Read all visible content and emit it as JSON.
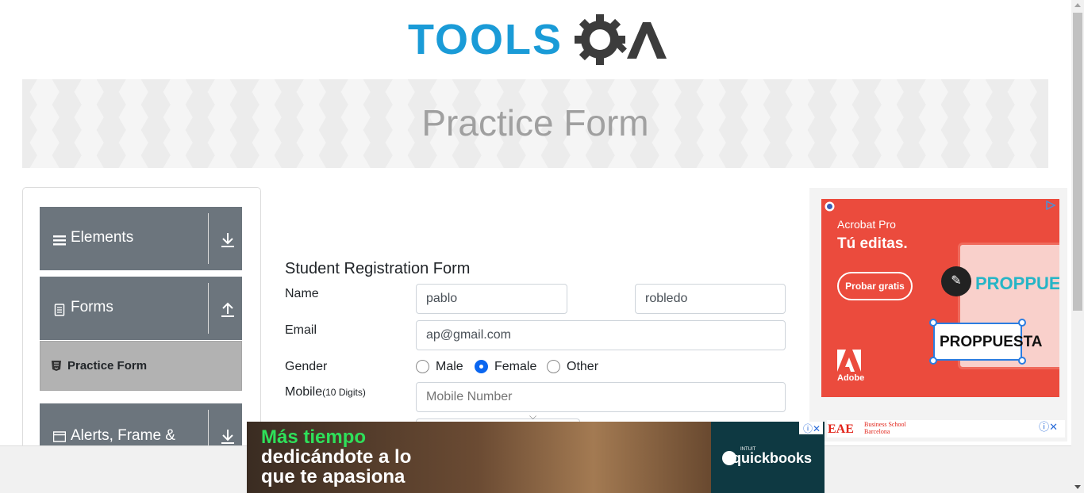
{
  "header": {
    "logo_text": "TOOLSQA"
  },
  "banner": {
    "title": "Practice Form"
  },
  "sidebar": {
    "groups": [
      {
        "label": "Elements",
        "icon": "hamburger-icon",
        "arrow": "download-arrow-icon"
      },
      {
        "label": "Forms",
        "icon": "document-icon",
        "arrow": "upload-arrow-icon"
      },
      {
        "label": "Alerts, Frame &",
        "icon": "window-icon",
        "arrow": "download-arrow-icon"
      }
    ],
    "active_item": {
      "label": "Practice Form",
      "icon": "html5-icon"
    }
  },
  "form": {
    "title": "Student Registration Form",
    "name_label": "Name",
    "first_name_value": "pablo",
    "last_name_value": "robledo",
    "email_label": "Email",
    "email_value": "ap@gmail.com",
    "gender_label": "Gender",
    "gender_options": [
      {
        "label": "Male",
        "selected": false
      },
      {
        "label": "Female",
        "selected": true
      },
      {
        "label": "Other",
        "selected": false
      }
    ],
    "mobile_label": "Mobile",
    "mobile_hint": "(10 Digits)",
    "mobile_placeholder": "Mobile Number"
  },
  "right_ad": {
    "brand": "Acrobat Pro",
    "tagline": "Tú editas.",
    "cta": "Probar gratis",
    "screen_word": "PROPPUESTA",
    "selected_word": "PROPPUESTA",
    "adobe_word": "Adobe",
    "accent_color": "#eb4b3d"
  },
  "eae_ad": {
    "logo": "EAE",
    "sub_line1": "Business School",
    "sub_line2": "Barcelona",
    "close": "ⓘ✕"
  },
  "bottom_ad": {
    "line1": "Más tiempo",
    "line2": "dedicándote a lo",
    "line3": "que te apasiona",
    "brand_small": "INTUIT",
    "brand": "quickbooks",
    "close": "ⓘ✕"
  }
}
